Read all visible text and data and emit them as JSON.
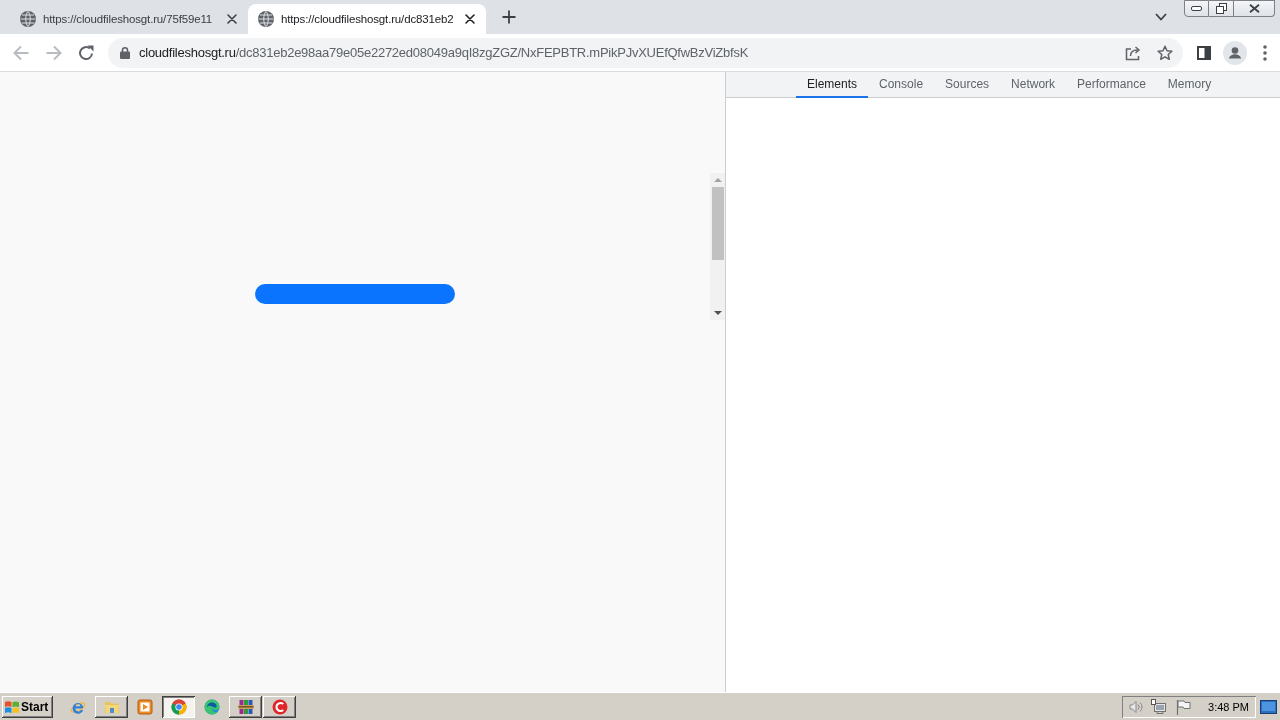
{
  "browser": {
    "tabs": [
      {
        "title": "https://cloudfileshosgt.ru/75f59e11",
        "selected": false
      },
      {
        "title": "https://cloudfileshosgt.ru/dc831eb2",
        "selected": true
      }
    ],
    "toolbar": {
      "back": {
        "disabled": true
      },
      "forward": {
        "disabled": true
      },
      "address": {
        "host": "cloudfileshosgt.ru",
        "path": "/dc831eb2e98aa79e05e2272ed08049a9qI8zgZGZ/NxFEPBTR.mPikPJvXUEfQfwBzViZbfsK"
      }
    }
  },
  "devtools": {
    "tabs": [
      {
        "label": "Elements",
        "selected": true
      },
      {
        "label": "Console",
        "selected": false
      },
      {
        "label": "Sources",
        "selected": false
      },
      {
        "label": "Network",
        "selected": false
      },
      {
        "label": "Performance",
        "selected": false
      },
      {
        "label": "Memory",
        "selected": false
      }
    ]
  },
  "taskbar": {
    "start": "Start",
    "items": [
      {
        "kind": "ie",
        "running": false,
        "selected": false
      },
      {
        "kind": "folder",
        "running": true,
        "selected": false
      },
      {
        "kind": "player",
        "running": false,
        "selected": false
      },
      {
        "kind": "chrome",
        "running": true,
        "selected": true
      },
      {
        "kind": "edge",
        "running": false,
        "selected": false
      },
      {
        "kind": "archive",
        "running": true,
        "selected": false
      },
      {
        "kind": "cleaner",
        "running": true,
        "selected": false
      }
    ],
    "clock": "3:48 PM"
  }
}
